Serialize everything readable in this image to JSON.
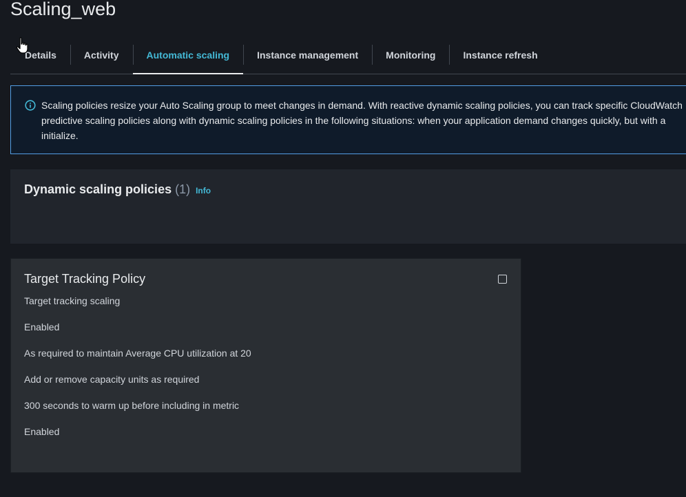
{
  "page": {
    "title": "Scaling_web"
  },
  "tabs": [
    {
      "label": "Details",
      "active": false
    },
    {
      "label": "Activity",
      "active": false
    },
    {
      "label": "Automatic scaling",
      "active": true
    },
    {
      "label": "Instance management",
      "active": false
    },
    {
      "label": "Monitoring",
      "active": false
    },
    {
      "label": "Instance refresh",
      "active": false
    }
  ],
  "alert": {
    "icon": "info-circle-icon",
    "lines": [
      "Scaling policies resize your Auto Scaling group to meet changes in demand. With reactive dynamic scaling policies, you can track specific CloudWatch",
      "predictive scaling policies along with dynamic scaling policies in the following situations: when your application demand changes quickly, but with a",
      "initialize."
    ]
  },
  "dynamic_policies": {
    "title": "Dynamic scaling policies",
    "count": "(1)",
    "info_link": "Info"
  },
  "policy": {
    "name": "Target Tracking Policy",
    "lines": [
      "Target tracking scaling",
      "Enabled",
      "As required to maintain Average CPU utilization at 20",
      "Add or remove capacity units as required",
      "300 seconds to warm up before including in metric",
      "Enabled"
    ]
  },
  "colors": {
    "background": "#16191f",
    "accent": "#44b9d6",
    "alert_border": "#539fe5"
  }
}
